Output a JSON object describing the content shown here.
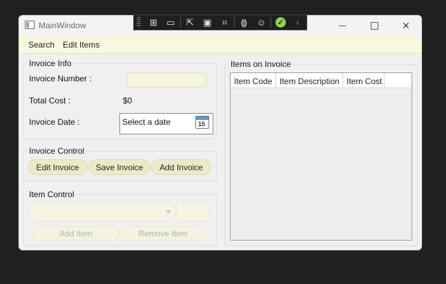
{
  "window": {
    "title": "MainWindow"
  },
  "menu": {
    "items": [
      "Search",
      "Edit Items"
    ]
  },
  "invoice_info": {
    "legend": "Invoice Info",
    "invoice_number_label": "Invoice Number :",
    "invoice_number_value": "",
    "total_cost_label": "Total Cost :",
    "total_cost_value": "$0",
    "invoice_date_label": "Invoice Date :",
    "invoice_date_placeholder": "Select a date",
    "calendar_day": "15"
  },
  "invoice_control": {
    "legend": "Invoice Control",
    "buttons": [
      "Edit Invoice",
      "Save Invoice",
      "Add Invoice"
    ]
  },
  "item_control": {
    "legend": "Item Control",
    "item_combo_value": "",
    "item_cost_value": "",
    "buttons": [
      "Add Item",
      "Remove Item"
    ]
  },
  "items_on_invoice": {
    "legend": "Items on Invoice",
    "columns": [
      "Item Code",
      "Item Description",
      "Item Cost"
    ],
    "rows": []
  },
  "colors": {
    "accent_pill": "#ecebc9",
    "menubar": "#f8f7df",
    "textbox": "#f6f4d9",
    "devbar_ok": "#8fd14f"
  }
}
